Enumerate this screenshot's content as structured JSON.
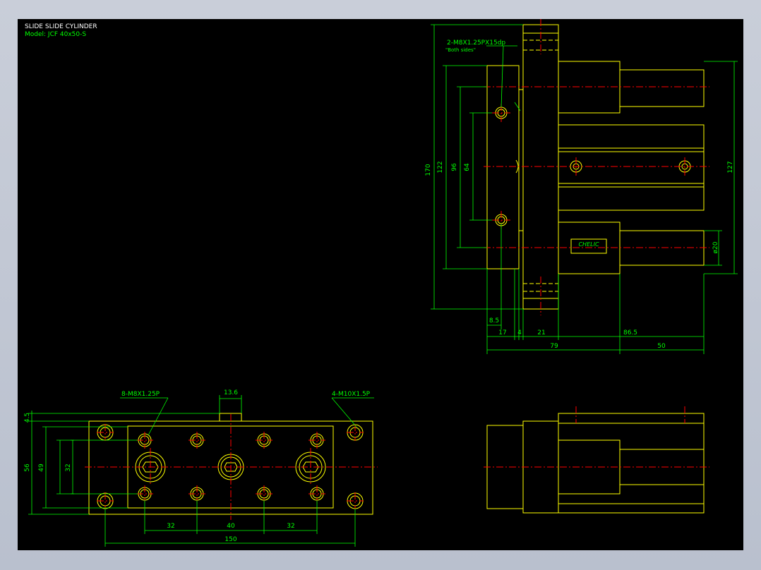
{
  "title_block": {
    "title": "SLIDE SLIDE CYLINDER",
    "model": "Model: JCF 40x50-S"
  },
  "colors": {
    "background": "#000000",
    "outline": "#ffff00",
    "dimension": "#00ff00",
    "centerline": "#ff0000",
    "title": "#ffffff",
    "frame": "#c9ced9"
  },
  "side_view": {
    "callout_text": "2-M8X1.25PX15dp",
    "callout_note": "\"Both sides\"",
    "brand": "CHELIC",
    "dim_170": "170",
    "dim_122": "122",
    "dim_96": "96",
    "dim_64": "64",
    "dim_127": "127",
    "dim_phi20": "ø20",
    "dim_8_5": "8.5",
    "dim_17": "17",
    "dim_4": "4",
    "dim_21": "21",
    "dim_86_5": "86.5",
    "dim_79": "79",
    "dim_50": "50"
  },
  "plan_view": {
    "callout_left": "8-M8X1.25P",
    "callout_right": "4-M10X1.5P",
    "dim_13_6": "13.6",
    "dim_4_5": "4.5",
    "dim_56": "56",
    "dim_49": "49",
    "dim_32_vertical": "32",
    "dim_32_left": "32",
    "dim_40": "40",
    "dim_32_right": "32",
    "dim_150": "150"
  }
}
